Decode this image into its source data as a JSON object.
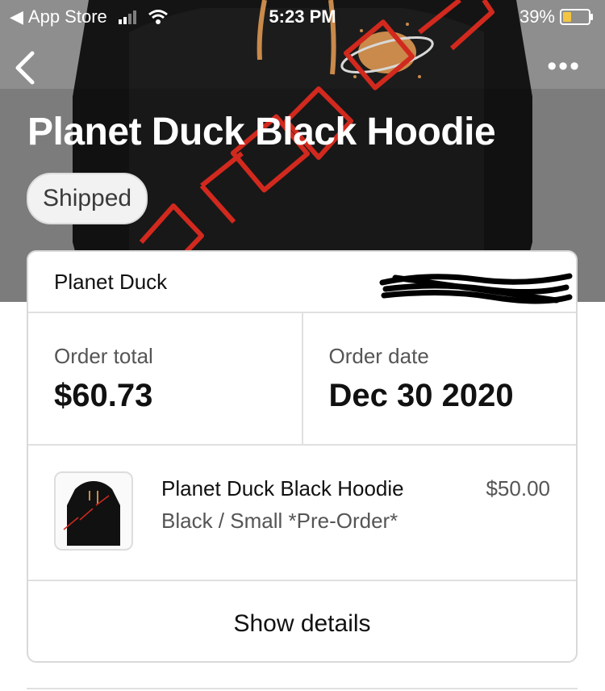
{
  "status_bar": {
    "back_app_label": "App Store",
    "time": "5:23 PM",
    "battery_percent": "39%",
    "battery_level": 0.39,
    "signal_bars": 2
  },
  "header": {
    "title": "Planet Duck Black Hoodie",
    "status_pill": "Shipped",
    "back_icon": "chevron-left-icon",
    "more_icon": "ellipsis-icon",
    "more_label": "•••"
  },
  "order": {
    "shop_name": "Planet Duck",
    "total_label": "Order total",
    "total_value": "$60.73",
    "date_label": "Order date",
    "date_value": "Dec 30 2020"
  },
  "item": {
    "name": "Planet Duck Black Hoodie",
    "variant": "Black / Small *Pre-Order*",
    "price": "$50.00"
  },
  "details_button": "Show details",
  "colors": {
    "accent_red": "#d2291e",
    "pill_bg": "#f2f2f2",
    "battery_yellow": "#f4c542"
  }
}
